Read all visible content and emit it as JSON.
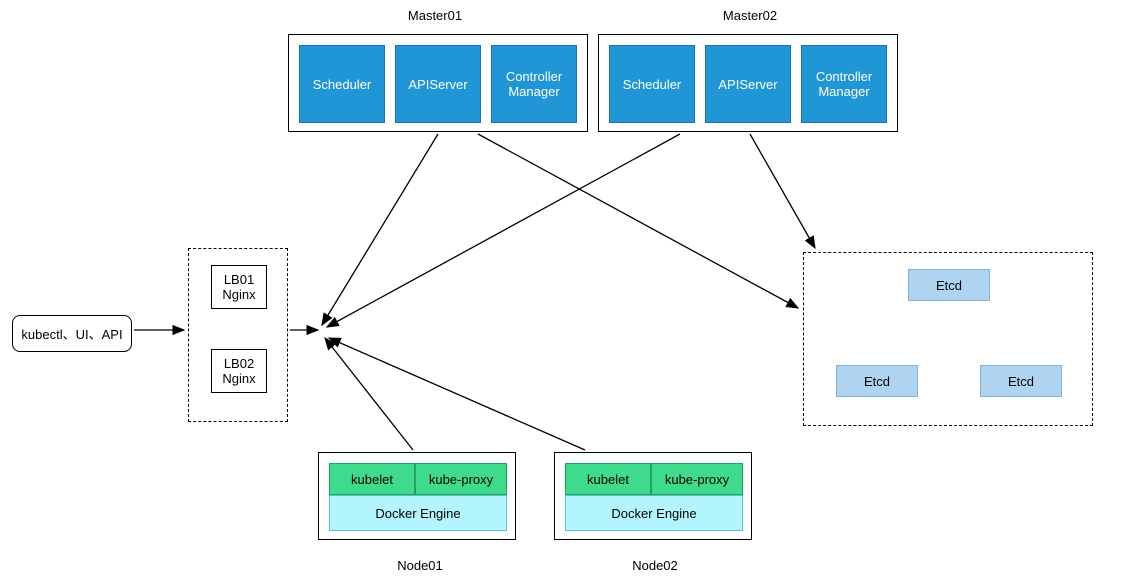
{
  "client": {
    "label": "kubectl、UI、API"
  },
  "lb": {
    "box1": {
      "line1": "LB01",
      "line2": "Nginx"
    },
    "box2": {
      "line1": "LB02",
      "line2": "Nginx"
    }
  },
  "masters": {
    "m1": {
      "title": "Master01",
      "scheduler": "Scheduler",
      "apiserver": "APIServer",
      "controller_line1": "Controller",
      "controller_line2": "Manager"
    },
    "m2": {
      "title": "Master02",
      "scheduler": "Scheduler",
      "apiserver": "APIServer",
      "controller_line1": "Controller",
      "controller_line2": "Manager"
    }
  },
  "nodes": {
    "n1": {
      "title": "Node01",
      "kubelet": "kubelet",
      "proxy": "kube-proxy",
      "engine": "Docker Engine"
    },
    "n2": {
      "title": "Node02",
      "kubelet": "kubelet",
      "proxy": "kube-proxy",
      "engine": "Docker Engine"
    }
  },
  "etcd": {
    "e1": "Etcd",
    "e2": "Etcd",
    "e3": "Etcd"
  }
}
